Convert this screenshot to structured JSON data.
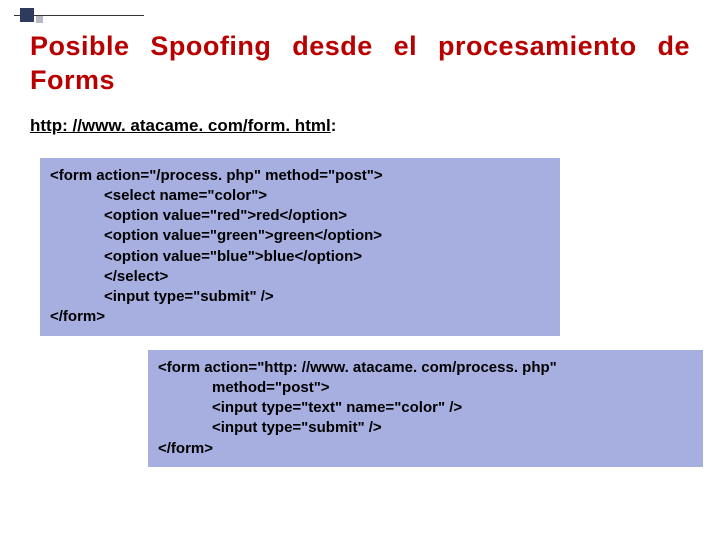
{
  "title": "Posible Spoofing desde el procesamiento de Forms",
  "url": "http: //www. atacame. com/form. html",
  "code1": {
    "l1": "<form action=\"/process. php\" method=\"post\">",
    "l2": "<select name=\"color\">",
    "l3": "<option value=\"red\">red</option>",
    "l4": "<option value=\"green\">green</option>",
    "l5": "<option value=\"blue\">blue</option>",
    "l6": "</select>",
    "l7": "<input type=\"submit\" />",
    "l8": "</form>"
  },
  "code2": {
    "l1": "<form action=\"http: //www. atacame. com/process. php\"",
    "l2": "method=\"post\">",
    "l3": "<input type=\"text\" name=\"color\" />",
    "l4": "<input type=\"submit\" />",
    "l5": "</form>"
  }
}
